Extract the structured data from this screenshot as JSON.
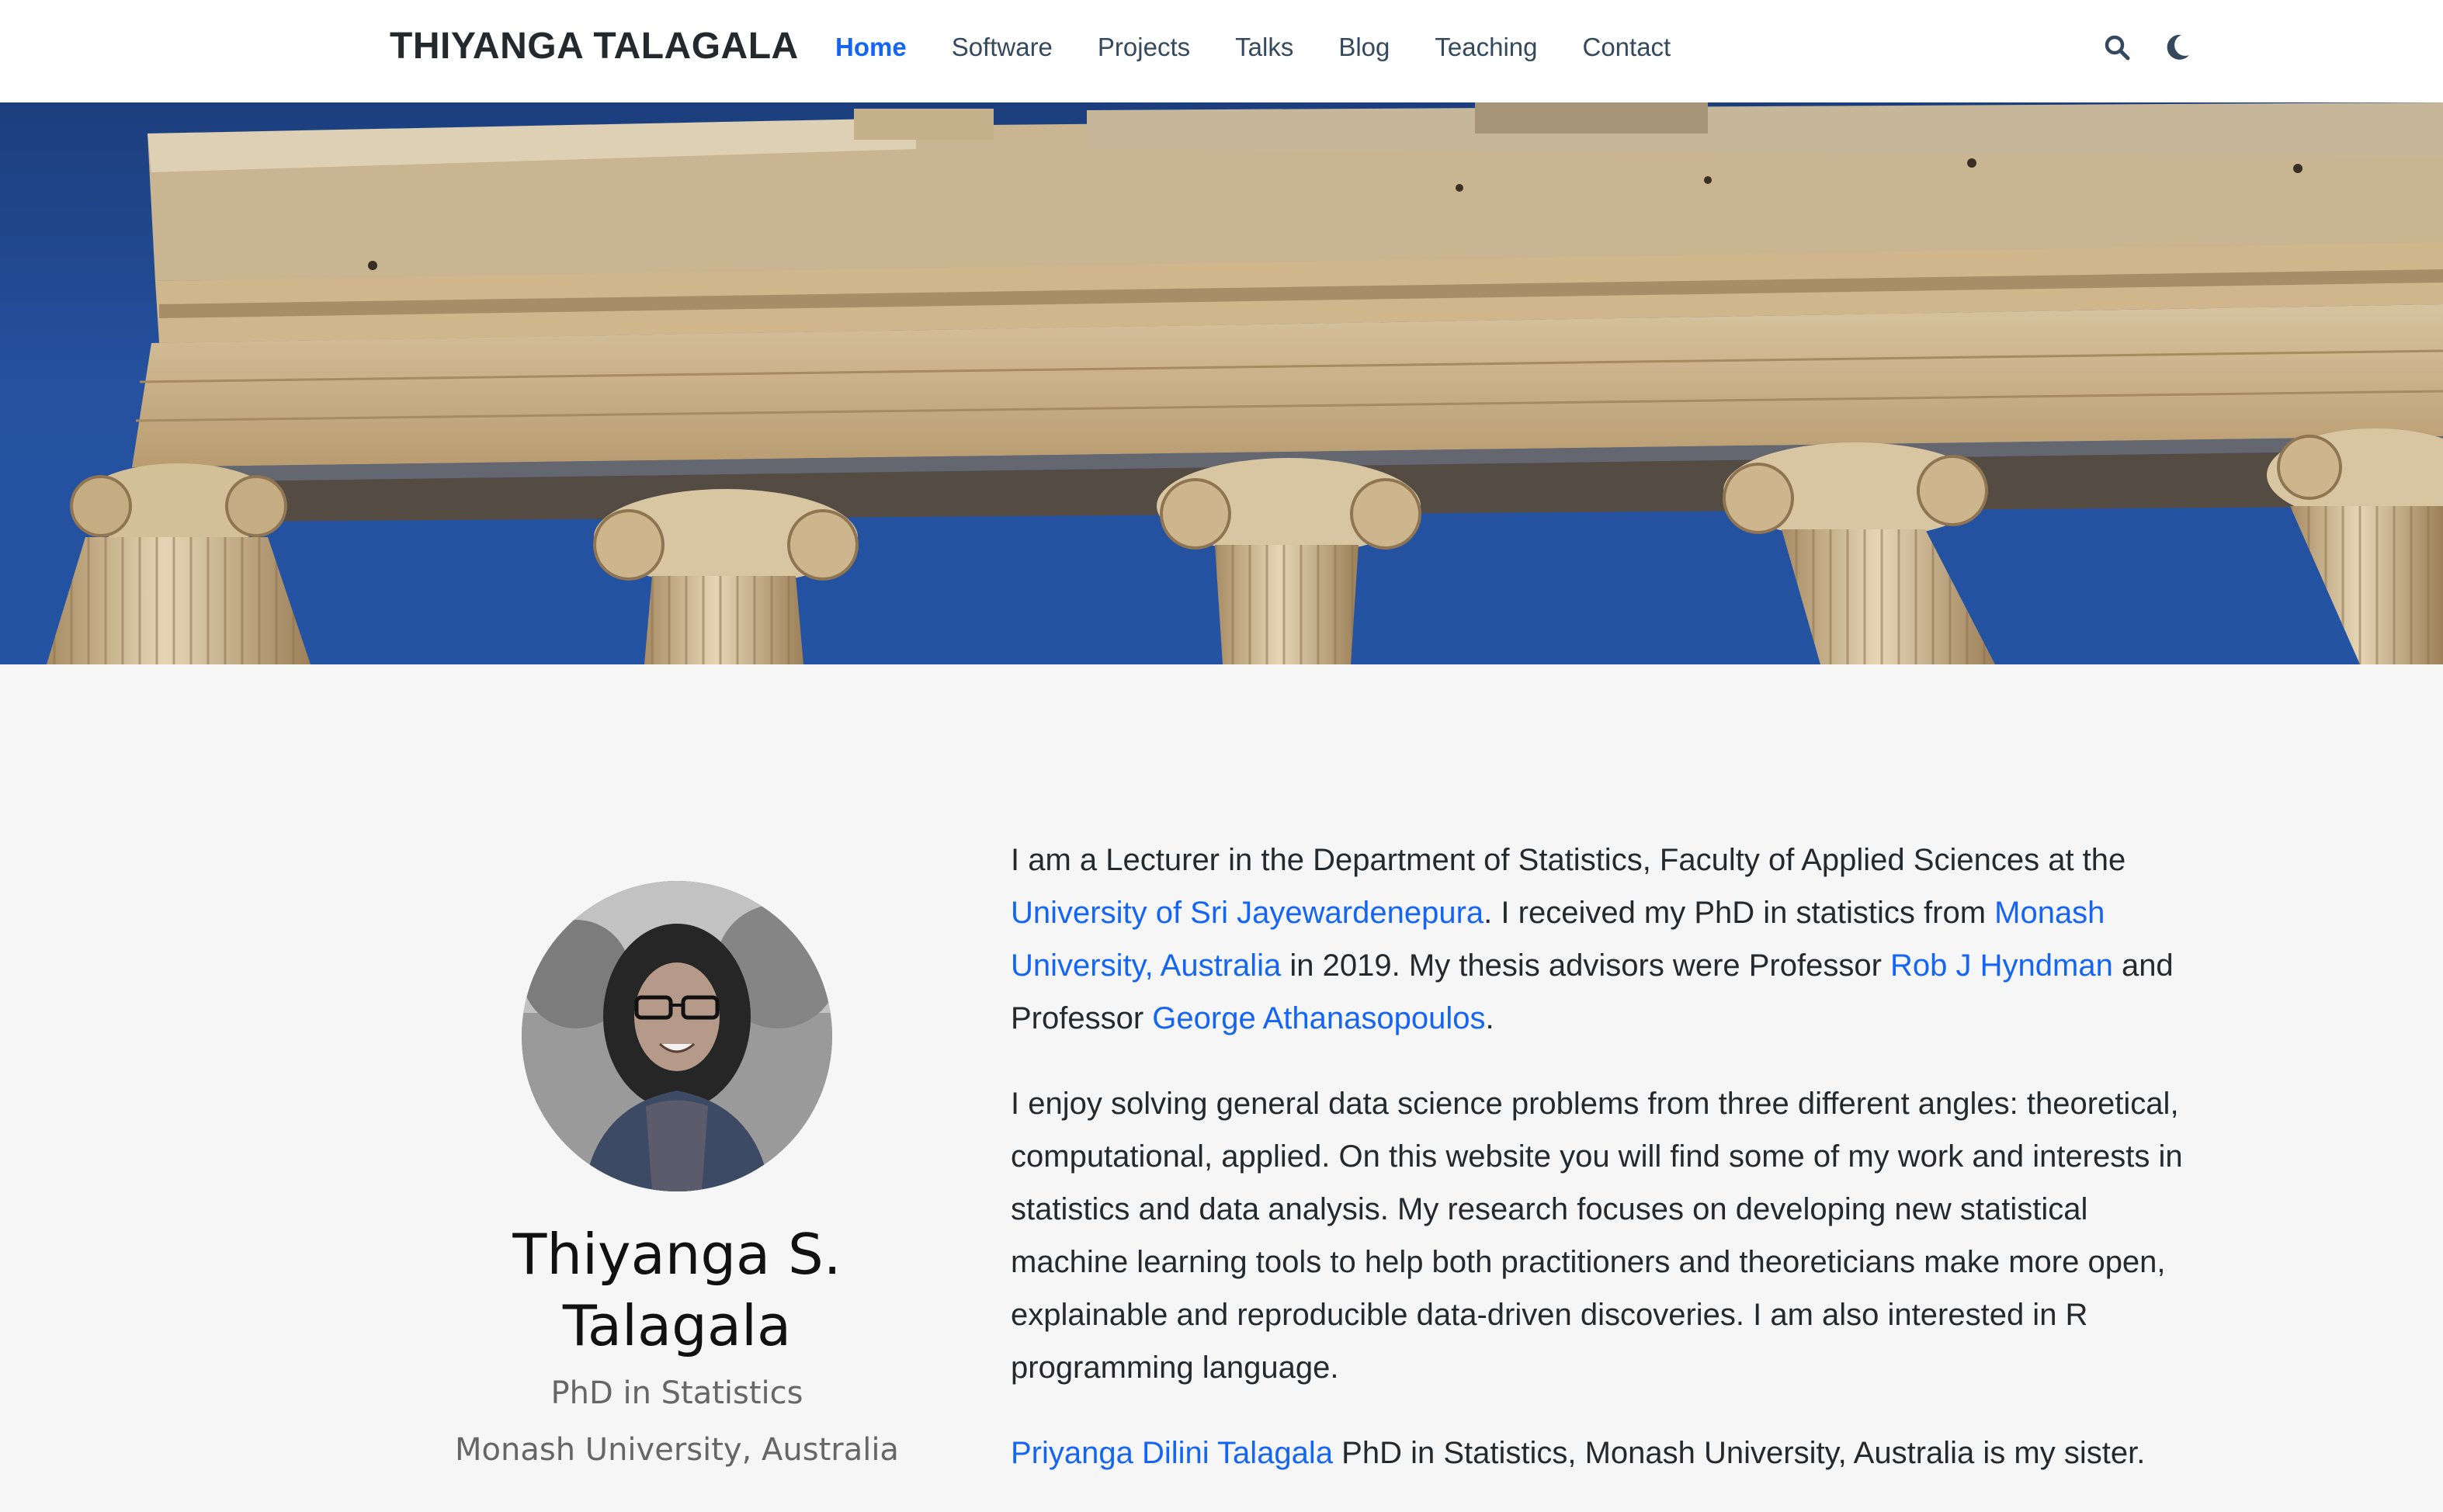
{
  "navbar": {
    "brand": "THIYANGA TALAGALA",
    "items": [
      {
        "label": "Home",
        "active": true
      },
      {
        "label": "Software"
      },
      {
        "label": "Projects"
      },
      {
        "label": "Talks"
      },
      {
        "label": "Blog"
      },
      {
        "label": "Teaching"
      },
      {
        "label": "Contact"
      }
    ],
    "icons": [
      "search-icon",
      "moon-icon"
    ]
  },
  "colors": {
    "accent": "#1565f5",
    "sky": "#2453a3",
    "background": "#f6f6f6"
  },
  "profile": {
    "name": "Thiyanga S. Talagala",
    "role": "PhD in Statistics",
    "organization": "Monash University, Australia"
  },
  "bio": {
    "p1": {
      "t1": "I am a Lecturer in the Department of Statistics, Faculty of Applied Sciences at the ",
      "link1": "University of Sri Jayewardenepura",
      "t2": ". I received my PhD in statistics from ",
      "link2": "Monash University, Australia",
      "t3": " in 2019. My thesis advisors were Professor ",
      "link3": "Rob J Hyndman",
      "t4": " and Professor ",
      "link4": "George Athanasopoulos",
      "t5": "."
    },
    "p2": "I enjoy solving general data science problems from three different angles: theoretical, computational, applied. On this website you will find some of my work and interests in statistics and data analysis. My research focuses on developing new statistical machine learning tools to help both practitioners and theoreticians make more open, explainable and reproducible data-driven discoveries. I am also interested in R programming language.",
    "p3": {
      "link": "Priyanga Dilini Talagala",
      "text": " PhD in Statistics, Monash University, Australia is my sister."
    }
  }
}
